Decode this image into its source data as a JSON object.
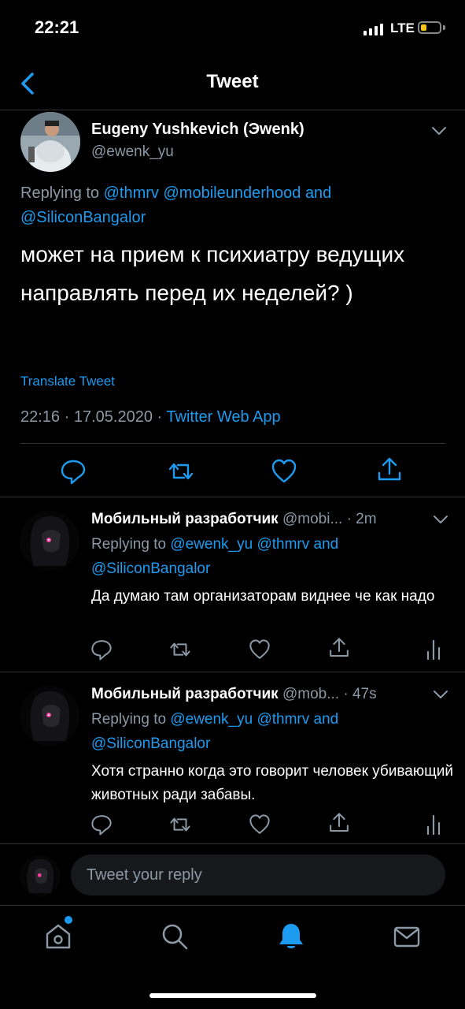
{
  "status_bar": {
    "time": "22:21",
    "network": "LTE"
  },
  "header": {
    "title": "Tweet"
  },
  "main_tweet": {
    "author_name": "Eugeny Yushkevich (Эwenk)",
    "author_handle": "@ewenk_yu",
    "replying_prefix": "Replying to",
    "replying_to_1": "@thmrv",
    "replying_to_2": "@mobileunderhood",
    "replying_and": "and",
    "replying_to_3": "@SiliconBangalor",
    "text": "может на прием к психиатру ведущих направлять перед их неделей? )",
    "translate_label": "Translate Tweet",
    "time": "22:16",
    "sep": "·",
    "date": "17.05.2020",
    "client": "Twitter Web App"
  },
  "replies": [
    {
      "author_name": "Мобильный разработчик",
      "author_handle": "@mobi...",
      "age": "2m",
      "replying_prefix": "Replying to",
      "replying_to_1": "@ewenk_yu",
      "replying_to_2": "@thmrv",
      "replying_and": "and",
      "replying_to_3": "@SiliconBangalor",
      "text": "Да думаю там организаторам виднее че как надо"
    },
    {
      "author_name": "Мобильный разработчик",
      "author_handle": "@mob...",
      "age": "47s",
      "replying_prefix": "Replying to",
      "replying_to_1": "@ewenk_yu",
      "replying_to_2": "@thmrv",
      "replying_and": "and",
      "replying_to_3": "@SiliconBangalor",
      "text": "Хотя странно когда это говорит человек убивающий животных ради забавы."
    }
  ],
  "composer": {
    "placeholder": "Tweet your reply"
  },
  "colors": {
    "accent": "#1d9bf0",
    "muted": "#8b98a5",
    "background": "#000000",
    "divider": "#2f3336"
  },
  "icons": {
    "tab_bar": [
      "home-icon",
      "search-icon",
      "notifications-icon",
      "messages-icon"
    ],
    "actions": [
      "reply-icon",
      "retweet-icon",
      "like-icon",
      "share-icon",
      "analytics-icon"
    ]
  }
}
